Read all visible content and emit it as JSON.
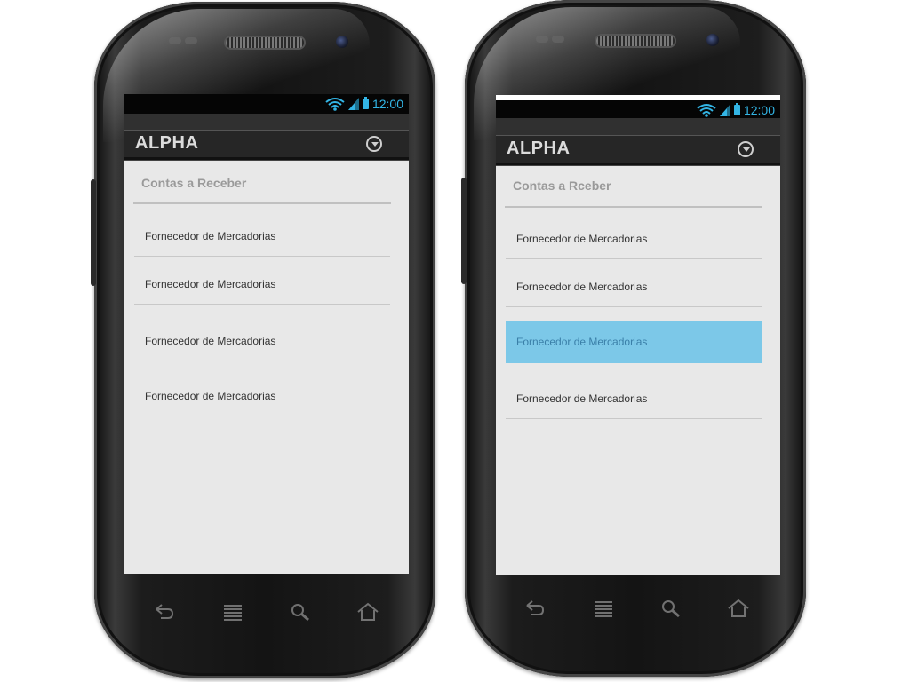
{
  "phones": [
    {
      "status_bar": {
        "time": "12:00"
      },
      "action_bar": {
        "title": "ALPHA"
      },
      "section": {
        "title": "Contas a Receber"
      },
      "items": [
        {
          "label": "Fornecedor de Mercadorias",
          "selected": false
        },
        {
          "label": "Fornecedor de Mercadorias",
          "selected": false
        },
        {
          "label": "Fornecedor de Mercadorias",
          "selected": false
        },
        {
          "label": "Fornecedor de Mercadorias",
          "selected": false
        }
      ]
    },
    {
      "status_bar": {
        "time": "12:00"
      },
      "action_bar": {
        "title": "ALPHA"
      },
      "section": {
        "title": "Contas a Rceber"
      },
      "items": [
        {
          "label": "Fornecedor de Mercadorias",
          "selected": false
        },
        {
          "label": "Fornecedor de Mercadorias",
          "selected": false
        },
        {
          "label": "Fornecedor de Mercadorias",
          "selected": true
        },
        {
          "label": "Fornecedor de Mercadorias",
          "selected": false
        }
      ]
    }
  ],
  "colors": {
    "accent": "#33b5e5",
    "selected_item_bg": "#7cc8e8",
    "screen_bg": "#e8e8e8",
    "action_bar_bg": "#262626"
  },
  "icons": {
    "status": [
      "wifi-icon",
      "signal-icon",
      "battery-icon"
    ],
    "action": [
      "dropdown-icon"
    ],
    "nav": [
      "back-icon",
      "menu-icon",
      "search-icon",
      "home-icon"
    ]
  }
}
